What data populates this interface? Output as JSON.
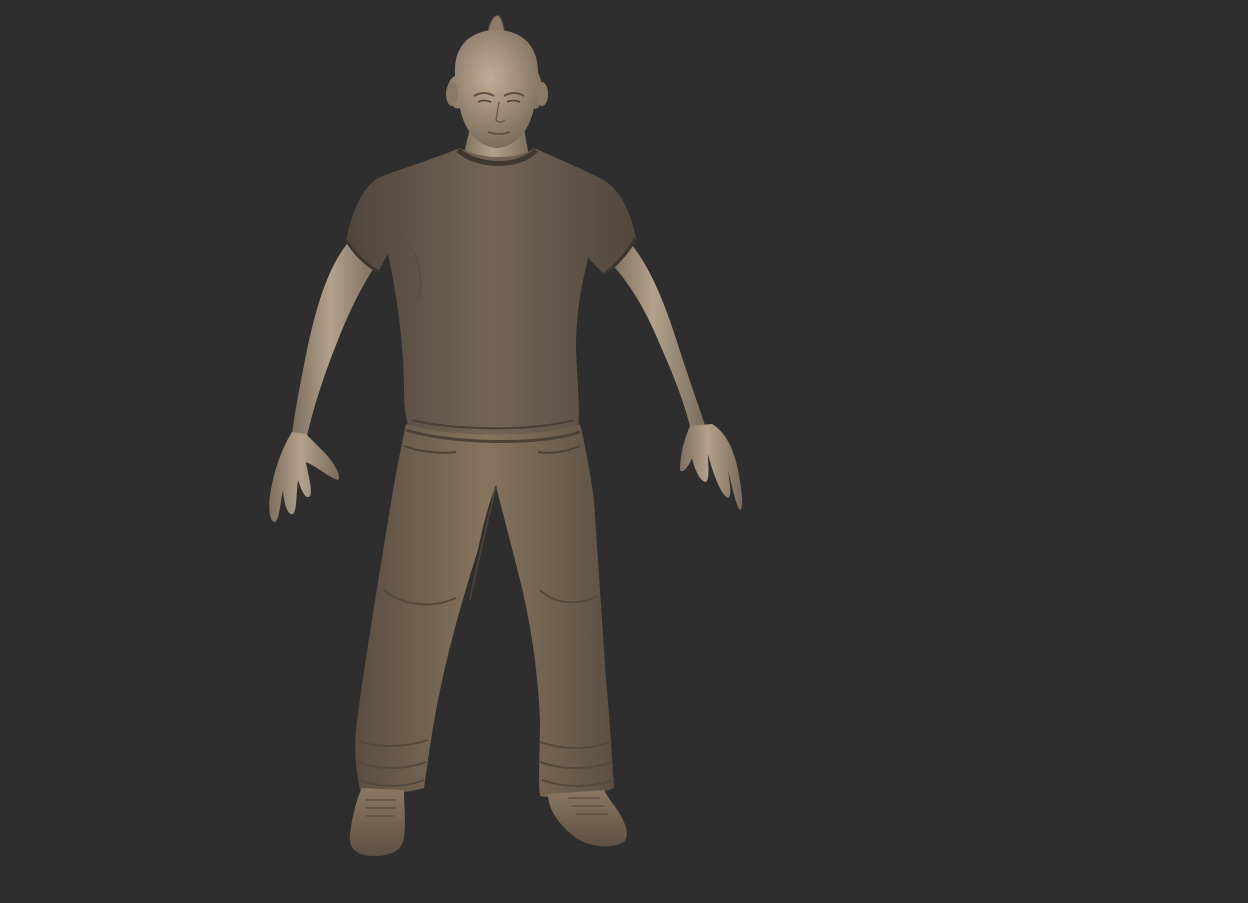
{
  "viewport": {
    "background_color": "#2e2e2e",
    "subject": {
      "icon": "sculpted-character-model",
      "skin_color": "#9c8b78",
      "shirt_color": "#6e6154",
      "pants_color": "#7a6a5a",
      "shoe_color": "#85735f",
      "shadow_color": "#3f362e"
    }
  }
}
